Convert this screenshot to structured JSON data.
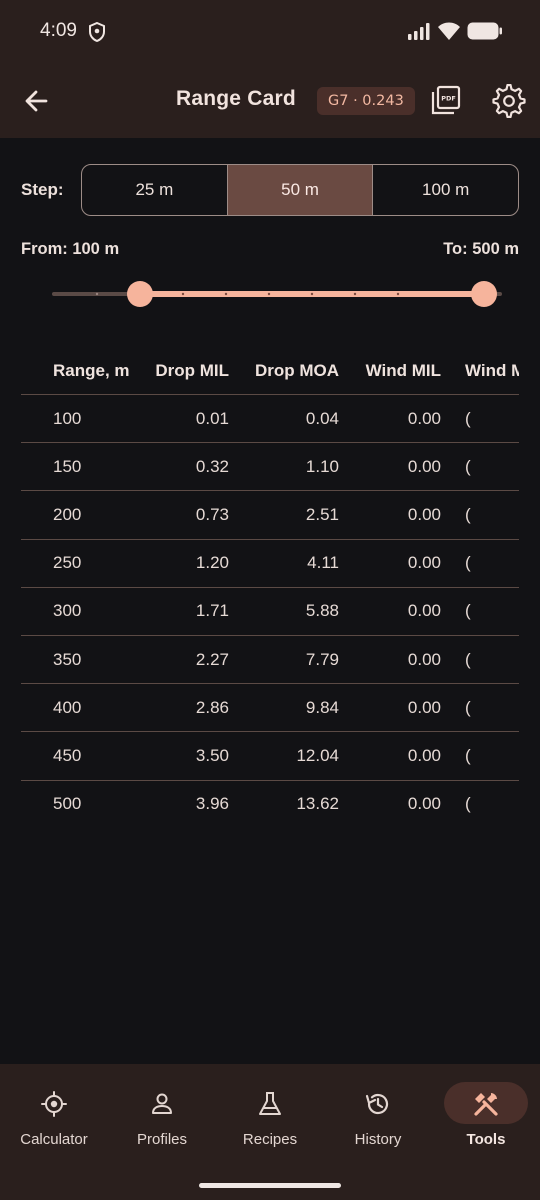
{
  "status": {
    "time": "4:09"
  },
  "appbar": {
    "title": "Range Card",
    "chip": "G7 · 0.243"
  },
  "step": {
    "label": "Step:",
    "options": [
      "25 m",
      "50 m",
      "100 m"
    ],
    "selected": "50 m"
  },
  "range": {
    "from_label": "From: 100 m",
    "to_label": "To: 500 m",
    "from_fraction": 0.2,
    "to_fraction": 1.0
  },
  "table": {
    "headers": [
      "Range, m",
      "Drop MIL",
      "Drop MOA",
      "Wind MIL",
      "Wind M"
    ],
    "rows": [
      [
        "100",
        "0.01",
        "0.04",
        "0.00",
        "("
      ],
      [
        "150",
        "0.32",
        "1.10",
        "0.00",
        "("
      ],
      [
        "200",
        "0.73",
        "2.51",
        "0.00",
        "("
      ],
      [
        "250",
        "1.20",
        "4.11",
        "0.00",
        "("
      ],
      [
        "300",
        "1.71",
        "5.88",
        "0.00",
        "("
      ],
      [
        "350",
        "2.27",
        "7.79",
        "0.00",
        "("
      ],
      [
        "400",
        "2.86",
        "9.84",
        "0.00",
        "("
      ],
      [
        "450",
        "3.50",
        "12.04",
        "0.00",
        "("
      ],
      [
        "500",
        "3.96",
        "13.62",
        "0.00",
        "("
      ]
    ]
  },
  "nav": {
    "items": [
      {
        "label": "Calculator",
        "icon": "crosshair-icon"
      },
      {
        "label": "Profiles",
        "icon": "person-icon"
      },
      {
        "label": "Recipes",
        "icon": "flask-icon"
      },
      {
        "label": "History",
        "icon": "history-icon"
      },
      {
        "label": "Tools",
        "icon": "tools-icon"
      }
    ],
    "active": "Tools"
  },
  "colors": {
    "accent": "#F6B49C",
    "surface": "#2A1F1D",
    "background": "#121215",
    "selected_segment": "#6A4A42"
  }
}
